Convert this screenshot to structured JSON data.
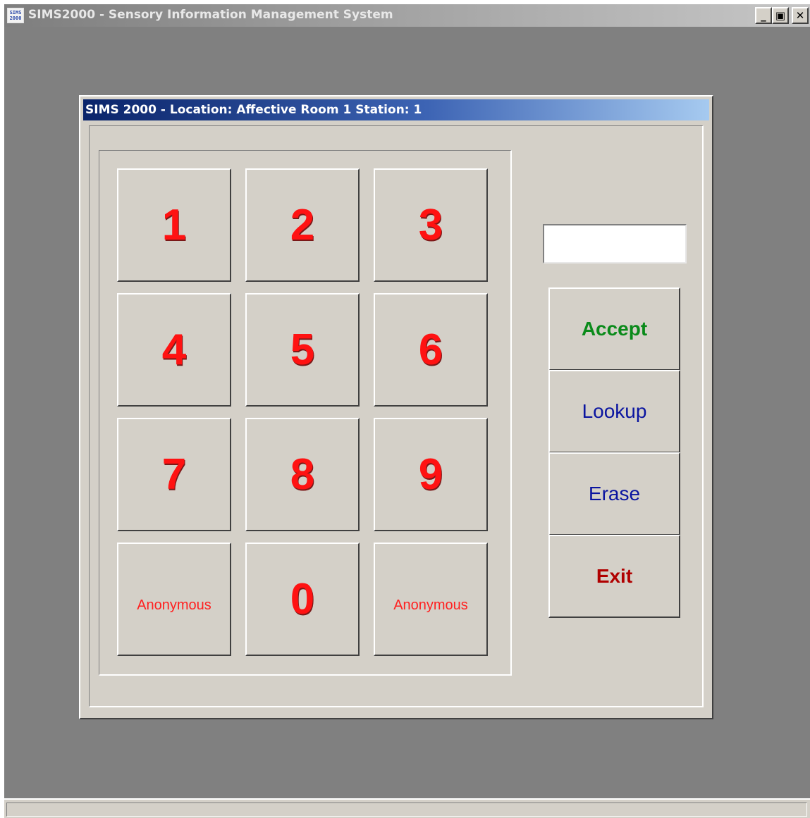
{
  "app": {
    "icon_text": "SIMS 2000",
    "title": "SIMS2000 - Sensory Information Management System",
    "controls": {
      "minimize": "_",
      "restore": "▣",
      "close": "✕"
    }
  },
  "dialog": {
    "title": "SIMS 2000  -  Location:  Affective Room 1   Station: 1"
  },
  "keypad": {
    "keys": [
      "1",
      "2",
      "3",
      "4",
      "5",
      "6",
      "7",
      "8",
      "9",
      "Anonymous",
      "0",
      "Anonymous"
    ]
  },
  "id_field": {
    "value": "",
    "placeholder": ""
  },
  "actions": {
    "accept": "Accept",
    "lookup": "Lookup",
    "erase": "Erase",
    "exit": "Exit"
  },
  "colors": {
    "digit": "#ff1212",
    "accept": "#0a8a1a",
    "lookup": "#0a14a0",
    "erase": "#0a14a0",
    "exit": "#b00000",
    "desktop": "#808080",
    "face": "#d4d0c8"
  },
  "statusbar": {
    "text": ""
  }
}
